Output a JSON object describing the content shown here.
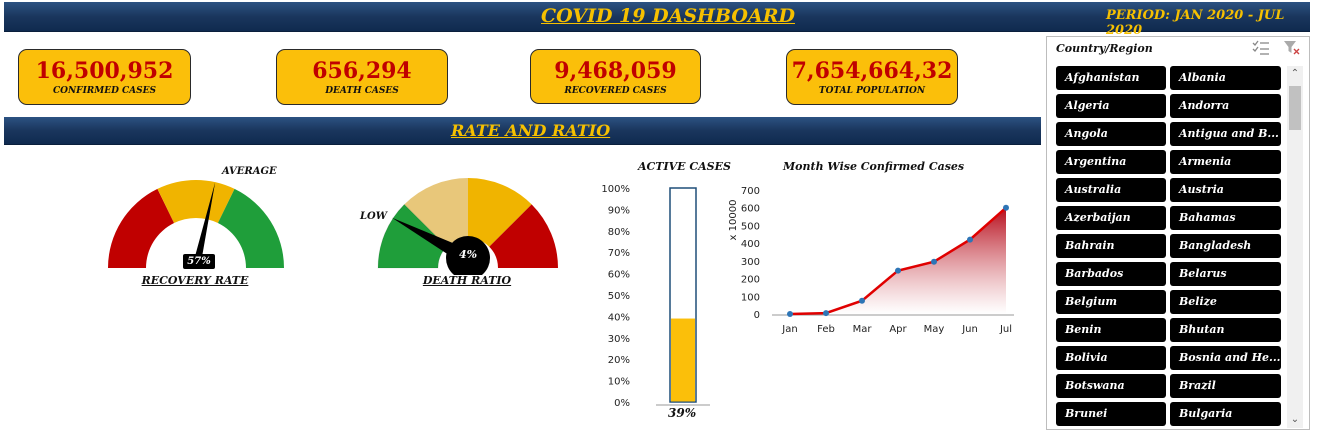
{
  "header": {
    "title": "COVID 19 DASHBOARD",
    "period": "PERIOD: JAN 2020 - JUL 2020"
  },
  "kpis": [
    {
      "value": "16,500,952",
      "label": "CONFIRMED CASES"
    },
    {
      "value": "656,294",
      "label": "DEATH CASES"
    },
    {
      "value": "9,468,059",
      "label": "RECOVERED CASES"
    },
    {
      "value": "7,654,664,32",
      "label": "TOTAL POPULATION"
    }
  ],
  "section": {
    "title": "RATE AND RATIO"
  },
  "recovery_gauge": {
    "label": "RECOVERY RATE",
    "value_text": "57%",
    "value": 0.57,
    "marker_label": "AVERAGE",
    "colors": {
      "low": "#c00000",
      "mid": "#f0b400",
      "high": "#1f9e3a"
    }
  },
  "death_gauge": {
    "label": "DEATH RATIO",
    "value_text": "4%",
    "value": 0.04,
    "marker_label": "LOW",
    "colors": {
      "low": "#1f9e3a",
      "mid": "#e8c77a",
      "mid2": "#f0b400",
      "high": "#c00000"
    }
  },
  "active_cases": {
    "title": "ACTIVE CASES",
    "value_text": "39%",
    "value": 0.39,
    "ticks": [
      "100%",
      "90%",
      "80%",
      "70%",
      "60%",
      "50%",
      "40%",
      "30%",
      "20%",
      "10%",
      "0%"
    ],
    "fill_color": "#fbbf0a",
    "border_color": "#1f4e79"
  },
  "chart_data": {
    "type": "area",
    "title": "Month Wise Confirmed Cases",
    "xlabel": "",
    "ylabel": "x 10000",
    "categories": [
      "Jan",
      "Feb",
      "Mar",
      "Apr",
      "May",
      "Jun",
      "Jul"
    ],
    "values": [
      0,
      5,
      75,
      245,
      295,
      420,
      600
    ],
    "ylim": [
      0,
      700
    ],
    "yticks": [
      "0",
      "100",
      "200",
      "300",
      "400",
      "500",
      "600",
      "700"
    ],
    "line_color": "#e00000",
    "marker_color": "#2e75b6",
    "grid": false
  },
  "slicer": {
    "title": "Country/Region",
    "multiselect_icon": "multi-select-icon",
    "clear_filter_icon": "clear-filter-icon",
    "items": [
      "Afghanistan",
      "Albania",
      "Algeria",
      "Andorra",
      "Angola",
      "Antigua and B...",
      "Argentina",
      "Armenia",
      "Australia",
      "Austria",
      "Azerbaijan",
      "Bahamas",
      "Bahrain",
      "Bangladesh",
      "Barbados",
      "Belarus",
      "Belgium",
      "Belize",
      "Benin",
      "Bhutan",
      "Bolivia",
      "Bosnia and He...",
      "Botswana",
      "Brazil",
      "Brunei",
      "Bulgaria"
    ]
  }
}
